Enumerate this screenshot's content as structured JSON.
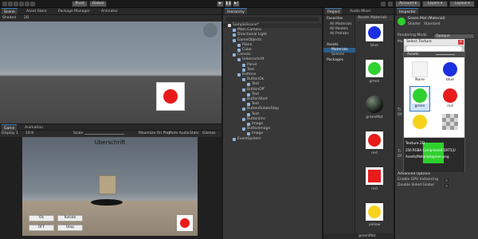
{
  "toolbar": {
    "pivot_label": "Pivot",
    "global_label": "Global",
    "account_label": "Account",
    "layers_label": "Layers",
    "layout_label": "Layout"
  },
  "scene_tabs": [
    "Scene",
    "Asset Store",
    "Package Manager",
    "Animator"
  ],
  "scene_toolbar": {
    "shading": "Shaded",
    "mode_2d": "2D"
  },
  "game_tabs": [
    "Game",
    "Animation"
  ],
  "game_toolbar": {
    "display": "Display 1",
    "aspect": "16:9",
    "scale_label": "Scale",
    "maximize": "Maximize On Play",
    "mute": "Mute Audio",
    "stats": "Stats",
    "gizmos": "Gizmos"
  },
  "game_view": {
    "heading": "Überschrift",
    "buttons": [
      {
        "label": "Ok"
      },
      {
        "label": "Rotate"
      },
      {
        "label": "OFF"
      },
      {
        "label": "Stop"
      }
    ]
  },
  "hierarchy": {
    "tab": "Hierarchy",
    "items": [
      {
        "label": "SampleScene*"
      },
      {
        "label": "Main Camera"
      },
      {
        "label": "Directional Light"
      },
      {
        "label": "GameObjects"
      },
      {
        "label": "Plane"
      },
      {
        "label": "Cube"
      },
      {
        "label": "Canvas"
      },
      {
        "label": "Ueberschrift"
      },
      {
        "label": "Panel"
      },
      {
        "label": "Text"
      },
      {
        "label": "buttons"
      },
      {
        "label": "ButtonOk"
      },
      {
        "label": "Text"
      },
      {
        "label": "ButtonOff"
      },
      {
        "label": "Text"
      },
      {
        "label": "ButtonStart"
      },
      {
        "label": "Text"
      },
      {
        "label": "ButtonRotateStop"
      },
      {
        "label": "Text"
      },
      {
        "label": "ButtonImc"
      },
      {
        "label": "Image"
      },
      {
        "label": "ButtonImage"
      },
      {
        "label": "Image"
      },
      {
        "label": "EventSystem"
      }
    ]
  },
  "project": {
    "tabs": [
      "Project",
      "Audio Mixer"
    ],
    "favorites": [
      "Favorites",
      "All Materials",
      "All Models",
      "All Prefabs"
    ],
    "folders": [
      "Assets",
      "Materials",
      "Scenes",
      "Packages"
    ],
    "breadcrumb": [
      "Assets",
      "Materials"
    ],
    "assets": [
      {
        "label": "blue",
        "color": "#1a2fe0",
        "type": "circle"
      },
      {
        "label": "green",
        "color": "#2fd12f",
        "type": "circle"
      },
      {
        "label": "greenMat",
        "color": "#1a3a1a",
        "type": "sphere"
      },
      {
        "label": "red",
        "color": "#e81b1b",
        "type": "circle"
      },
      {
        "label": "red",
        "color": "#e81b1b",
        "type": "square"
      },
      {
        "label": "yellow",
        "color": "#f7d21c",
        "type": "circle"
      }
    ],
    "footer": "greenMat"
  },
  "inspector": {
    "tab": "Inspector",
    "object_name": "Green Mat (Material)",
    "shader_label": "Shader",
    "shader_value": "Standard",
    "rendering_mode_label": "Rendering Mode",
    "rendering_mode_value": "Opaque",
    "main_maps_label": "Ma",
    "rows": [
      "Ti",
      "Of",
      "Ti",
      "Of"
    ],
    "advanced_options": "Advanced Options",
    "enable_gpu_instancing": "Enable GPU Instancing",
    "double_sided_gi": "Double Sided Global"
  },
  "select_texture": {
    "title": "Select Texture",
    "tab": "Assets",
    "items": [
      {
        "label": "None",
        "color": "#f4f4f4",
        "type": "none"
      },
      {
        "label": "blue",
        "color": "#1a2fe0",
        "type": "circle"
      },
      {
        "label": "green",
        "color": "#2fd12f",
        "type": "circle"
      },
      {
        "label": "red",
        "color": "#e81b1b",
        "type": "circle"
      },
      {
        "label": "",
        "color": "#f7d21c",
        "type": "circle"
      },
      {
        "label": "",
        "color": "#8a8a8a",
        "type": "checker"
      }
    ],
    "preview_title": "Texture 2D",
    "preview_info": "256 RGBA Compressed DXT5|U",
    "preview_path": "Assets/Materials/green.png"
  },
  "colors": {
    "unity_dark": "#191919",
    "panel": "#383838",
    "accent": "#3a79bb",
    "selection": "#2c5d87",
    "sky_top": "#7d8b97",
    "ground": "#4b4b4b",
    "game_floor": "#a89a87"
  }
}
